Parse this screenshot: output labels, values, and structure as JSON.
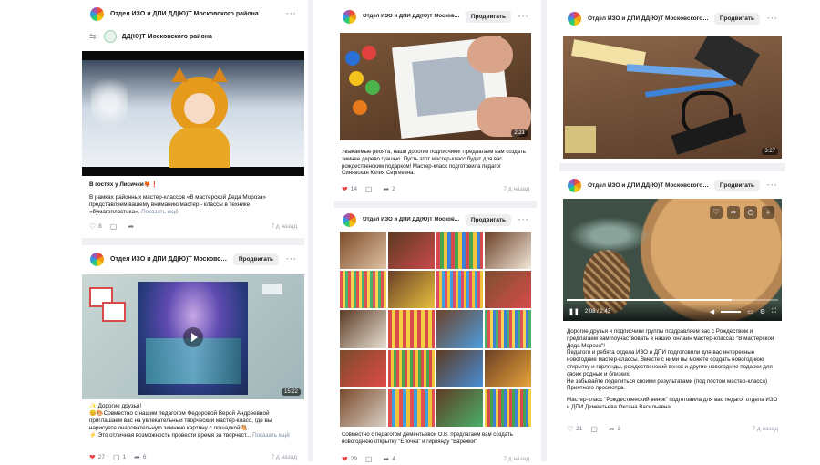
{
  "common": {
    "promote_label": "Продвигать",
    "show_more": "Показать ещё"
  },
  "col1": {
    "post1": {
      "author": "Отдел ИЗО и ДПИ ДД(Ю)Т Московского района",
      "repost_author": "ДД(Ю)Т Московского района",
      "title": "В гостях у Лисички🦊❗",
      "text": "В рамках районных мастер-классов «В мастерской Деда Мороза» представляем вашему вниманию мастер - классы в технике «бумагопластика».",
      "likes": "8",
      "time": "7 д назад"
    },
    "post2": {
      "author": "Отдел ИЗО и ДПИ ДД(Ю)Т Московского р...",
      "duration": "15:22",
      "text_lines": [
        "✨ Дорогие друзья!",
        "😊🎨Совместно с нашим педагогом Федоровой Верой Андреевной приглашаем вас на увлекательный творческий мастер-класс, где вы нарисуете очаровательную зимнюю картину с лошадкой🐴.",
        "⚡ Это отличная возможность провести время за творчест..."
      ],
      "likes": "27",
      "comments": "1",
      "reposts": "6",
      "time": "7 д назад"
    }
  },
  "col2": {
    "post1": {
      "author": "Отдел ИЗО и ДПИ ДД(Ю)Т Московского р...",
      "duration": "2:21",
      "text": "Уважаемые ребята, наши дорогие подписчики! Предлагаем вам создать зимнее дерево гуашью. Пусть этот мастер-класс будет для вас рождественским подарком! Мастер-класс подготовила педагог Синявская Юлия Сергеевна.",
      "likes": "14",
      "reposts": "2",
      "time": "7 д назад"
    },
    "post2": {
      "author": "Отдел ИЗО и ДПИ ДД(Ю)Т Московского р...",
      "text": "Совместно с педагогом Дементьевой О.В. предлагаем вам создать новогоднюю открытку \"Ёлочка\" и гирлянду \"Варежки\"",
      "likes": "29",
      "reposts": "4",
      "time": "7 д назад"
    }
  },
  "col3": {
    "post1": {
      "author": "Отдел ИЗО и ДПИ ДД(Ю)Т Московского р...",
      "duration": "3:27"
    },
    "post2": {
      "author": "Отдел ИЗО и ДПИ ДД(Ю)Т Московского района",
      "video_time": "2:08 / 2:43",
      "text_lines": [
        "Дорогие друзья и подписчики группы поздравляем вас с Рождеством и предлагаем вам поучаствовать в наших онлайн мастер-классах \"В мастерской Деда Мороза\"!",
        "Педагоги и ребята отдела ИЗО и ДПИ подготовили для вас интересные новогодние мастер-классы. Вместе с ними вы можете создать новогоднюю открытку и гирлянды, рождественский венок и другие новогодние подарки для своих родных и близких.",
        "Не забывайте поделиться своими результатами (под постом мастер-класса)",
        "Приятного просмотра.",
        "Мастер-класс \"Рождественский венок\" подготовила для вас педагог отдела ИЗО и ДПИ Дементьева Оксана Васильевна."
      ],
      "likes": "21",
      "reposts": "3",
      "time": "7 д назад"
    }
  }
}
